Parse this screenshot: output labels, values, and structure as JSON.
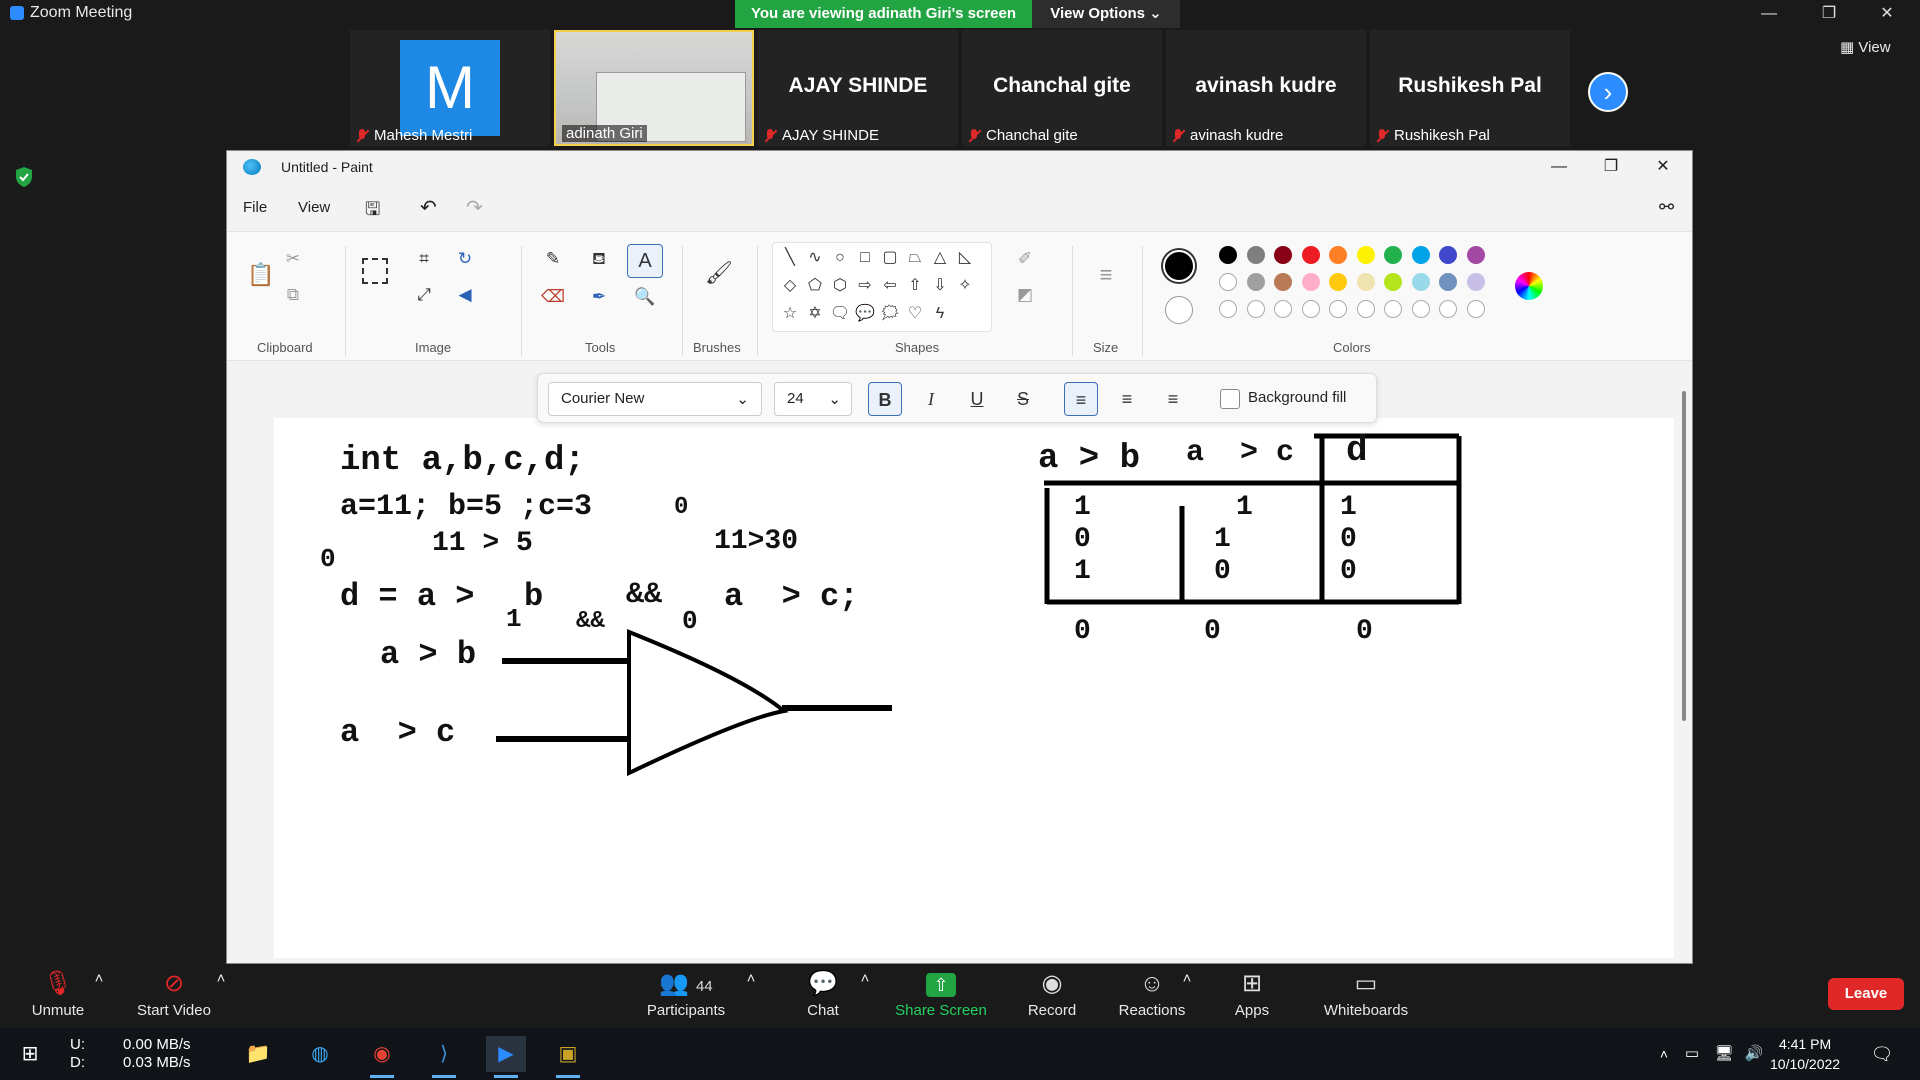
{
  "zoom": {
    "window_title": "Zoom Meeting",
    "viewing_banner": "You are viewing adinath Giri's screen",
    "view_options": "View Options",
    "view_button": "View",
    "next_arrow": "›",
    "participants_strip": [
      {
        "display": "M",
        "label": "Mahesh Mestri",
        "kind": "avatar"
      },
      {
        "display": "",
        "label": "adinath Giri",
        "kind": "video"
      },
      {
        "display": "AJAY SHINDE",
        "label": "AJAY SHINDE",
        "kind": "name"
      },
      {
        "display": "Chanchal gite",
        "label": "Chanchal gite",
        "kind": "name"
      },
      {
        "display": "avinash kudre",
        "label": "avinash kudre",
        "kind": "name"
      },
      {
        "display": "Rushikesh Pal",
        "label": "Rushikesh Pal",
        "kind": "name"
      }
    ],
    "controls": {
      "unmute": "Unmute",
      "start_video": "Start Video",
      "participants": "Participants",
      "participants_count": "44",
      "chat": "Chat",
      "share_screen": "Share Screen",
      "record": "Record",
      "reactions": "Reactions",
      "apps": "Apps",
      "whiteboards": "Whiteboards",
      "leave": "Leave"
    },
    "colors": {
      "banner": "#23a443",
      "leave": "#e02828",
      "accent": "#2d8cff"
    }
  },
  "paint": {
    "title": "Untitled - Paint",
    "menu": {
      "file": "File",
      "view": "View"
    },
    "groups": {
      "clipboard": "Clipboard",
      "image": "Image",
      "tools": "Tools",
      "brushes": "Brushes",
      "shapes": "Shapes",
      "size": "Size",
      "colors": "Colors"
    },
    "text_toolbar": {
      "font": "Courier New",
      "size": "24",
      "bold": "B",
      "italic": "I",
      "underline": "U",
      "strike": "S",
      "background_fill": "Background fill"
    },
    "palette_row1": [
      "#000000",
      "#7f7f7f",
      "#880015",
      "#ed1c24",
      "#ff7f27",
      "#fff200",
      "#22b14c",
      "#00a2e8",
      "#3f48cc",
      "#a349a4"
    ],
    "palette_row2": [
      "#ffffff",
      "#a0a0a0",
      "#b97a57",
      "#ffaec9",
      "#ffc90e",
      "#efe4b0",
      "#b5e61d",
      "#99d9ea",
      "#7092be",
      "#c8bfe7"
    ],
    "canvas": {
      "line1": "int a,b,c,d;",
      "line2a": "a=11; b=5 ;c=3",
      "line2b": "0",
      "line3a": "11 > 5",
      "line3b": "11>30",
      "zero_left": "0",
      "line4": "d = a >",
      "line4b": "b",
      "line4c": "&&",
      "line4d": "a  > c;",
      "sub1": "1",
      "sub_and": "&&",
      "sub0": "0",
      "gate_in1": "a > b",
      "gate_in2": "a  > c",
      "table_headers": {
        "h1": "a > b",
        "h2": "a  > c",
        "h3": "d"
      },
      "table_col1": [
        "1",
        "0",
        "1"
      ],
      "table_col2": [
        "1",
        "1",
        "0"
      ],
      "table_col3": [
        "1",
        "0",
        "0"
      ],
      "table_bottom": [
        "0",
        "0",
        "0"
      ]
    }
  },
  "taskbar": {
    "upload": "U:",
    "download": "D:",
    "upload_speed": "0.00 MB/s",
    "download_speed": "0.03 MB/s",
    "time": "4:41 PM",
    "date": "10/10/2022"
  }
}
